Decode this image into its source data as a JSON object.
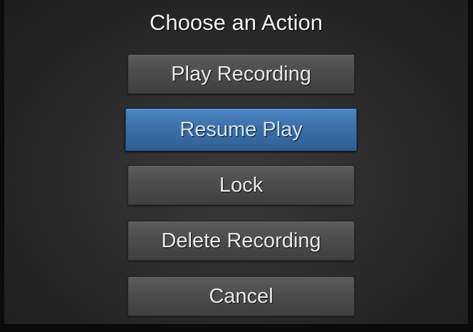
{
  "dialog": {
    "title": "Choose an Action"
  },
  "menu": {
    "items": [
      {
        "label": "Play Recording"
      },
      {
        "label": "Resume Play"
      },
      {
        "label": "Lock"
      },
      {
        "label": "Delete Recording"
      },
      {
        "label": "Cancel"
      }
    ],
    "selected_index": 1
  },
  "colors": {
    "highlight": "#3c6fa8",
    "button": "#4b4b4b",
    "background": "#2c2c2c",
    "text": "#e9e9e9",
    "selected_text": "#cfe6ff"
  }
}
